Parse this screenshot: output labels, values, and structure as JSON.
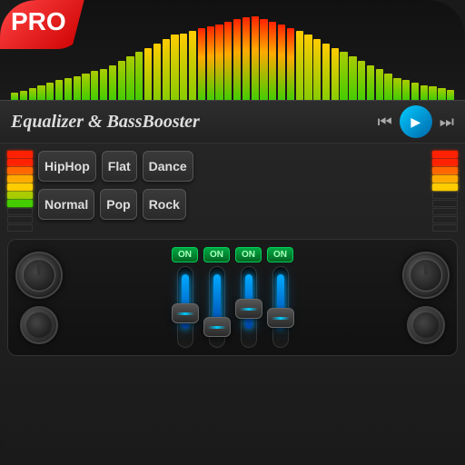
{
  "app": {
    "pro_badge": "PRO",
    "title": "Equalizer & BassBooster",
    "border_radius": "40px"
  },
  "controls": {
    "prev_label": "⏮",
    "play_label": "▶",
    "next_label": "⏭"
  },
  "presets": {
    "row1": [
      "HipHop",
      "Flat",
      "Dance"
    ],
    "row2": [
      "Normal",
      "Pop",
      "Rock"
    ]
  },
  "faders": {
    "channels": [
      {
        "on_label": "ON",
        "position": 40
      },
      {
        "on_label": "ON",
        "position": 55
      },
      {
        "on_label": "ON",
        "position": 35
      },
      {
        "on_label": "ON",
        "position": 45
      }
    ]
  },
  "spectrum": {
    "bars": [
      3,
      5,
      8,
      12,
      15,
      18,
      20,
      22,
      25,
      28,
      30,
      35,
      40,
      45,
      50,
      55,
      60,
      65,
      70,
      72,
      75,
      78,
      80,
      82,
      85,
      88,
      90,
      92,
      88,
      85,
      82,
      78,
      75,
      70,
      65,
      60,
      55,
      50,
      45,
      40,
      35,
      30,
      25,
      20,
      18,
      15,
      12,
      10,
      8,
      6
    ]
  },
  "colors": {
    "green": "#44cc00",
    "yellow": "#ffcc00",
    "red": "#ff2200",
    "cyan": "#00ccff",
    "dark_bg": "#1a1a1a",
    "medium_bg": "#252525"
  }
}
